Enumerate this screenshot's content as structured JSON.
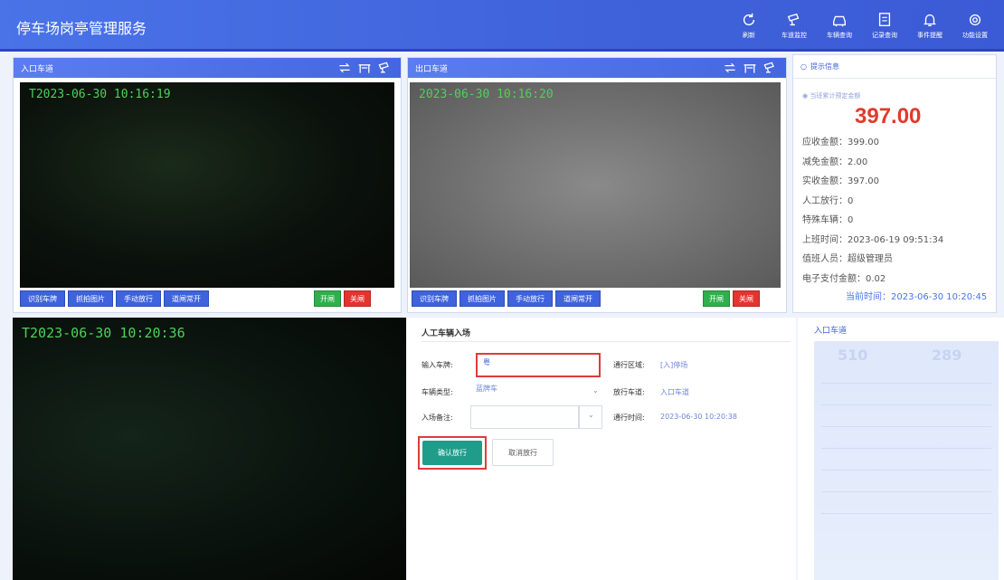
{
  "app": {
    "title": "停车场岗亭管理服务"
  },
  "toolbar": [
    {
      "label": "刷新",
      "icon": "refresh-icon"
    },
    {
      "label": "车道监控",
      "icon": "camera-icon"
    },
    {
      "label": "车辆查询",
      "icon": "car-icon"
    },
    {
      "label": "记录查询",
      "icon": "record-icon"
    },
    {
      "label": "事件提醒",
      "icon": "bell-icon"
    },
    {
      "label": "功能设置",
      "icon": "gear-icon"
    }
  ],
  "entry_lane": {
    "title": "入口车道",
    "timestamp": "T2023-06-30 10:16:19",
    "buttons": [
      "识别车牌",
      "抓拍图片",
      "手动放行",
      "道闸常开"
    ],
    "open": "开闸",
    "close": "关闸"
  },
  "exit_lane": {
    "title": "出口车道",
    "timestamp": "2023-06-30 10:16:20",
    "buttons": [
      "识别车牌",
      "抓拍图片",
      "手动放行",
      "道闸常开"
    ],
    "open": "开闸",
    "close": "关闸"
  },
  "tip": {
    "title": "提示信息",
    "subtitle": "当班累计预定金额",
    "total": "397.00",
    "lines": [
      "应收金额：399.00",
      "减免金额：2.00",
      "实收金额：397.00",
      "人工放行：0",
      "特殊车辆：0",
      "上班时间：2023-06-19 09:51:34",
      "值班人员：超级管理员",
      "电子支付金额：0.02"
    ],
    "current_time": "当前时间：2023-06-30 10:20:45"
  },
  "big_camera": {
    "timestamp": "T2023-06-30 10:20:36"
  },
  "form": {
    "title": "人工车辆入场",
    "plate_label": "输入车牌:",
    "plate_value": "粤",
    "area_label": "通行区域:",
    "area_value": "[入]停场",
    "type_label": "车辆类型:",
    "type_value": "蓝牌车",
    "lane_label": "放行车道:",
    "lane_value": "入口车道",
    "remark_label": "入场备注:",
    "remark_value": "",
    "time_label": "通行时间:",
    "time_value": "2023-06-30 10:20:38",
    "confirm": "确认放行",
    "cancel": "取消放行"
  },
  "entry_panel": {
    "title": "入口车道",
    "stat_left": "510",
    "stat_right": "289"
  }
}
